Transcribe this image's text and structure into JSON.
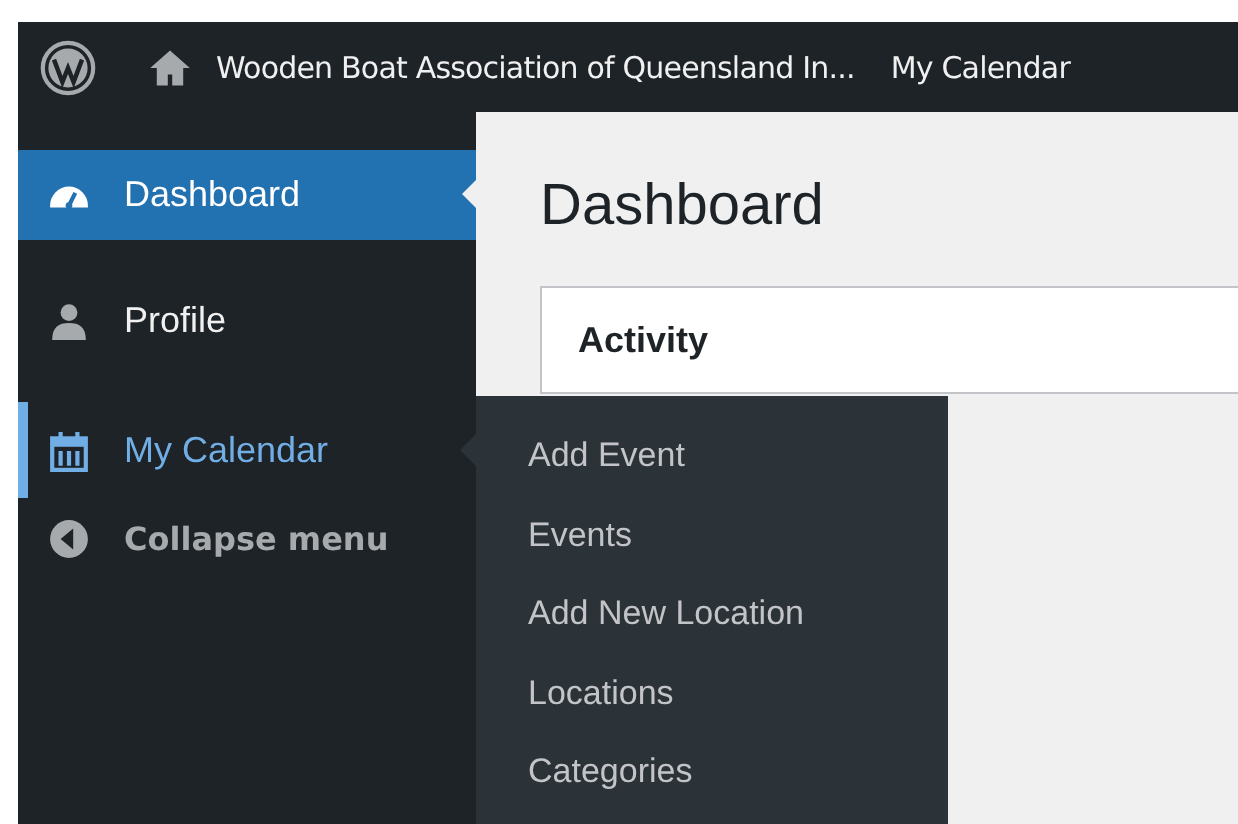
{
  "admin_bar": {
    "site_title": "Wooden Boat Association of Queensland In...",
    "items": [
      "My Calendar"
    ]
  },
  "sidebar": {
    "items": [
      {
        "label": "Dashboard",
        "selected": true,
        "expanded": false
      },
      {
        "label": "Profile",
        "selected": false,
        "expanded": false
      },
      {
        "label": "My Calendar",
        "selected": false,
        "expanded": true,
        "submenu": [
          "Add Event",
          "Events",
          "Add New Location",
          "Locations",
          "Categories"
        ]
      }
    ],
    "collapse": "Collapse menu"
  },
  "main": {
    "title": "Dashboard",
    "panels": [
      "Activity"
    ]
  }
}
